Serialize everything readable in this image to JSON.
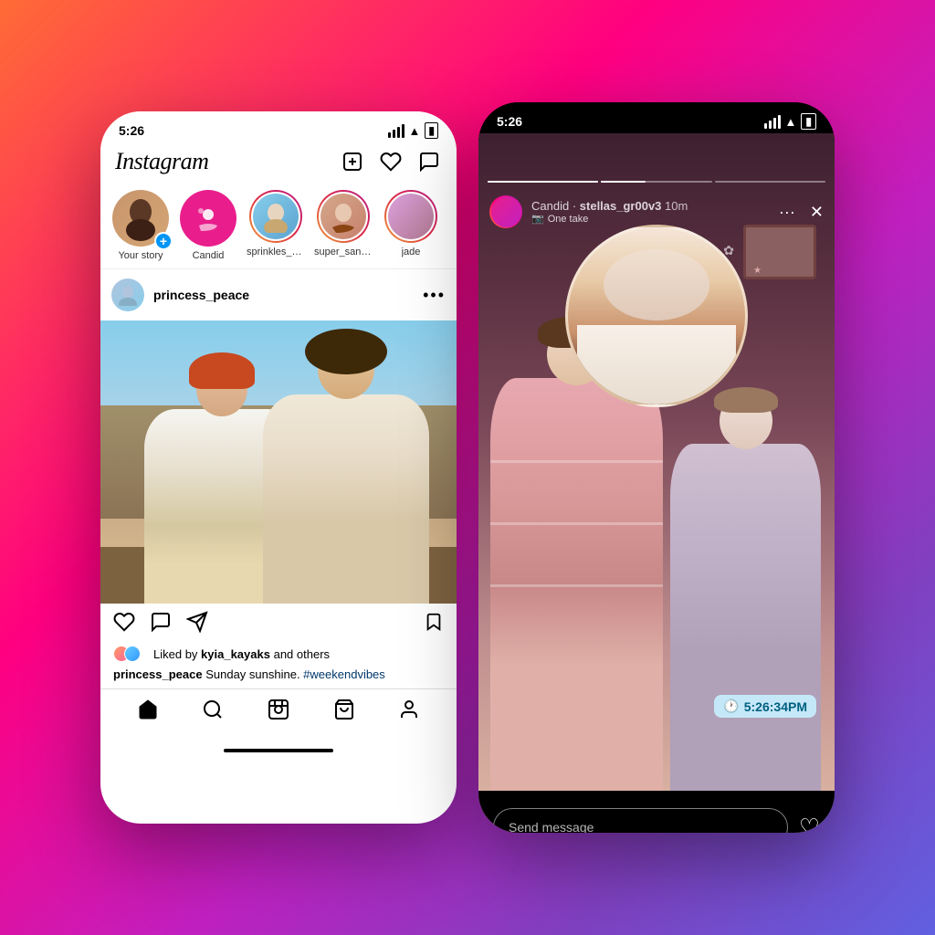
{
  "background": {
    "gradient": "linear-gradient(135deg, #ff6b35 0%, #ff0080 35%, #c020c0 60%, #8040c0 80%, #6060e0 100%)"
  },
  "phone1": {
    "status_bar": {
      "time": "5:26",
      "signal": "●●●",
      "wifi": "WiFi",
      "battery": "Battery"
    },
    "header": {
      "logo": "Instagram",
      "add_icon": "⊕",
      "heart_icon": "♡",
      "messenger_icon": "✉"
    },
    "stories": [
      {
        "id": "your-story",
        "label": "Your story",
        "type": "your_story"
      },
      {
        "id": "candid",
        "label": "Candid",
        "type": "candid"
      },
      {
        "id": "sprinkles",
        "label": "sprinkles_b...",
        "type": "user"
      },
      {
        "id": "super_santi",
        "label": "super_santi...",
        "type": "user"
      },
      {
        "id": "jade",
        "label": "jade",
        "type": "user"
      }
    ],
    "post": {
      "username": "princess_peace",
      "more": "•••",
      "likes_text": "Liked by",
      "likes_user": "kyia_kayaks",
      "likes_suffix": " and others",
      "caption_user": "princess_peace",
      "caption_text": " Sunday sunshine. ",
      "caption_hashtag": "#weekendvibes"
    },
    "nav": {
      "items": [
        "🏠",
        "🔍",
        "⊞",
        "🛍",
        "👤"
      ]
    }
  },
  "phone2": {
    "status_bar": {
      "time": "5:26",
      "signal": "●●●",
      "wifi": "WiFi",
      "battery": "Battery"
    },
    "story_header": {
      "username": "Candid",
      "separator": " · ",
      "account": "stellas_gr00v3",
      "time": "10m",
      "sub": "One take",
      "more_icon": "···",
      "close_icon": "✕"
    },
    "time_sticker": {
      "icon": "🕐",
      "time": "5:26:34PM"
    },
    "bottom": {
      "placeholder": "Send message",
      "heart": "♡"
    }
  }
}
